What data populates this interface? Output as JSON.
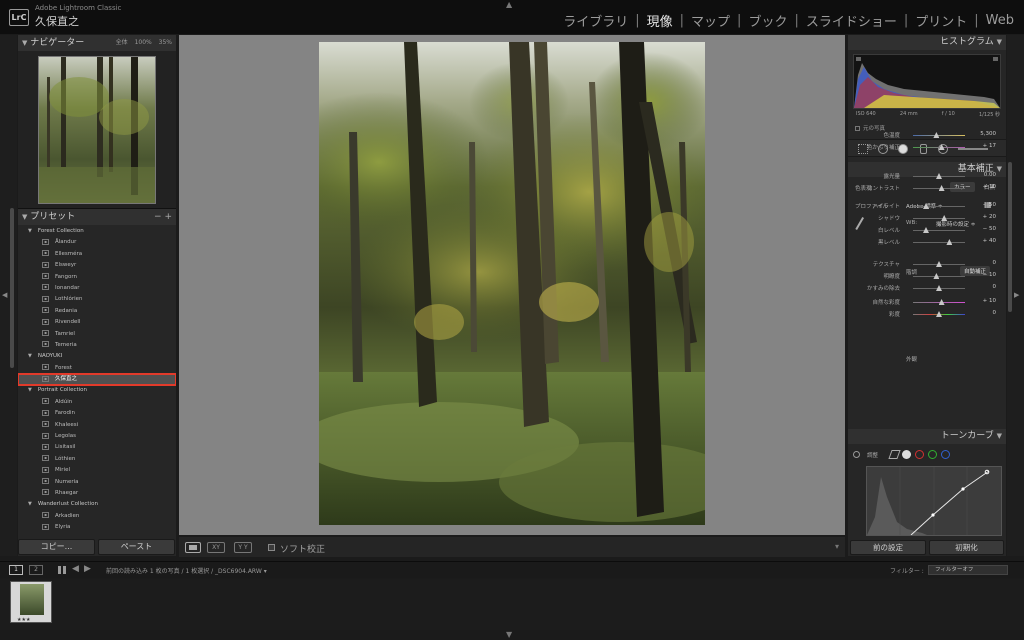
{
  "app": {
    "logo": "LrC",
    "name": "Adobe Lightroom Classic",
    "user": "久保直之"
  },
  "modules": [
    {
      "label": "ライブラリ",
      "active": false
    },
    {
      "label": "現像",
      "active": true
    },
    {
      "label": "マップ",
      "active": false
    },
    {
      "label": "ブック",
      "active": false
    },
    {
      "label": "スライドショー",
      "active": false
    },
    {
      "label": "プリント",
      "active": false
    },
    {
      "label": "Web",
      "active": false
    }
  ],
  "navigator": {
    "title": "ナビゲーター",
    "zoom_options": [
      "全体",
      "100%",
      "35%"
    ]
  },
  "presets": {
    "title": "プリセット",
    "controls": "− +",
    "rows": [
      {
        "type": "folder",
        "label": "Forest Collection"
      },
      {
        "type": "item",
        "label": "Ålandur"
      },
      {
        "type": "item",
        "label": "Ellesméra"
      },
      {
        "type": "item",
        "label": "Elsweyr"
      },
      {
        "type": "item",
        "label": "Fangorn"
      },
      {
        "type": "item",
        "label": "Ionandar"
      },
      {
        "type": "item",
        "label": "Lothlórien"
      },
      {
        "type": "item",
        "label": "Redania"
      },
      {
        "type": "item",
        "label": "Rivendell"
      },
      {
        "type": "item",
        "label": "Tamriel"
      },
      {
        "type": "item",
        "label": "Temeria"
      },
      {
        "type": "folder",
        "label": "NAOYUKI"
      },
      {
        "type": "item",
        "label": "Forest"
      },
      {
        "type": "item",
        "label": "久保直之",
        "selected": true
      },
      {
        "type": "folder",
        "label": "Portrait Collection"
      },
      {
        "type": "item",
        "label": "Aldúin"
      },
      {
        "type": "item",
        "label": "Farodin"
      },
      {
        "type": "item",
        "label": "Khaleesi"
      },
      {
        "type": "item",
        "label": "Legolas"
      },
      {
        "type": "item",
        "label": "Lisitasil"
      },
      {
        "type": "item",
        "label": "Lóthien"
      },
      {
        "type": "item",
        "label": "Miriel"
      },
      {
        "type": "item",
        "label": "Numeria"
      },
      {
        "type": "item",
        "label": "Rhaegar"
      },
      {
        "type": "folder",
        "label": "Wanderlust Collection"
      },
      {
        "type": "item",
        "label": "Arkadien"
      },
      {
        "type": "item",
        "label": "Elyria"
      }
    ]
  },
  "left_buttons": {
    "copy": "コピー...",
    "paste": "ペースト"
  },
  "toolbar": {
    "compare": "XY",
    "survey": "Y Y",
    "soft_proof": "ソフト校正",
    "menu": "▾"
  },
  "histogram": {
    "title": "ヒストグラム",
    "iso": "ISO 640",
    "focal": "24 mm",
    "aperture": "f / 10",
    "shutter": "1/125 秒",
    "original_label": "元の写真"
  },
  "basic": {
    "title": "基本補正",
    "treatment_label": "色表現",
    "treatment_color": "カラー",
    "treatment_bw": "白黒",
    "profile_label": "プロファイル",
    "profile_value": "Adobe 標準 ≑",
    "wb_label": "WB:",
    "wb_value": "撮影時の設定 ≑",
    "tone_label": "階調",
    "auto": "自動補正",
    "presence_label": "外観",
    "sliders": [
      {
        "label": "色温度",
        "value": "5,300",
        "pos": 0.45,
        "grad": "grad-temp"
      },
      {
        "label": "色かぶり補正",
        "value": "+ 17",
        "pos": 0.55,
        "grad": "grad-tint"
      },
      {
        "label": "露光量",
        "value": "0.00",
        "pos": 0.5,
        "grad": ""
      },
      {
        "label": "コントラスト",
        "value": "+ 10",
        "pos": 0.55,
        "grad": ""
      },
      {
        "label": "ハイライト",
        "value": "− 50",
        "pos": 0.25,
        "grad": ""
      },
      {
        "label": "シャドウ",
        "value": "+ 20",
        "pos": 0.6,
        "grad": ""
      },
      {
        "label": "白レベル",
        "value": "− 50",
        "pos": 0.25,
        "grad": ""
      },
      {
        "label": "黒レベル",
        "value": "+ 40",
        "pos": 0.7,
        "grad": ""
      },
      {
        "label": "テクスチャ",
        "value": "0",
        "pos": 0.5,
        "grad": ""
      },
      {
        "label": "明瞭度",
        "value": "− 10",
        "pos": 0.45,
        "grad": ""
      },
      {
        "label": "かすみの除去",
        "value": "0",
        "pos": 0.5,
        "grad": ""
      },
      {
        "label": "自然な彩度",
        "value": "+ 10",
        "pos": 0.55,
        "grad": "grad-vib"
      },
      {
        "label": "彩度",
        "value": "0",
        "pos": 0.5,
        "grad": "grad-sat"
      }
    ]
  },
  "tone_curve": {
    "title": "トーンカーブ",
    "adjust_label": "調整"
  },
  "right_buttons": {
    "previous": "前の設定",
    "reset": "初期化"
  },
  "filmstrip": {
    "monitor1": "1",
    "monitor2": "2",
    "source": "前回の読み込み  1 枚の写真 / 1 枚選択 / _DSC6904.ARW ▾",
    "filter_label": "フィルター :",
    "filter_value": "フィルターオフ",
    "stars": "★★★"
  }
}
